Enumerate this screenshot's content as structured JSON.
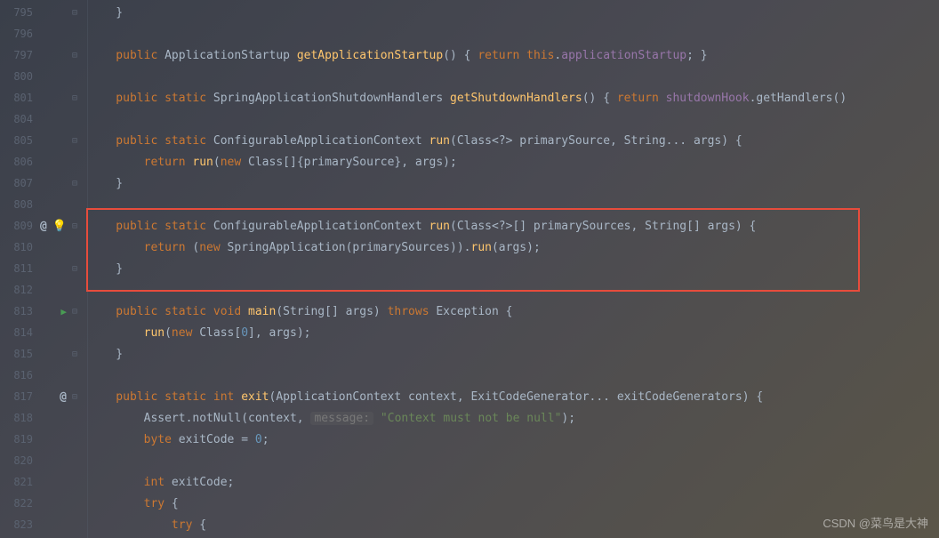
{
  "lines": [
    {
      "num": "795",
      "marks": [
        "fold"
      ],
      "code": [
        {
          "c": "punct",
          "t": "    }"
        }
      ]
    },
    {
      "num": "796",
      "marks": [],
      "code": []
    },
    {
      "num": "797",
      "marks": [
        "fold"
      ],
      "code": [
        {
          "c": "kw",
          "t": "    public "
        },
        {
          "c": "type",
          "t": "ApplicationStartup "
        },
        {
          "c": "method",
          "t": "getApplicationStartup"
        },
        {
          "c": "punct",
          "t": "() { "
        },
        {
          "c": "kw",
          "t": "return this"
        },
        {
          "c": "punct",
          "t": "."
        },
        {
          "c": "field",
          "t": "applicationStartup"
        },
        {
          "c": "punct",
          "t": "; }"
        }
      ]
    },
    {
      "num": "800",
      "marks": [],
      "code": []
    },
    {
      "num": "801",
      "marks": [
        "fold"
      ],
      "code": [
        {
          "c": "kw",
          "t": "    public static "
        },
        {
          "c": "type",
          "t": "SpringApplicationShutdownHandlers "
        },
        {
          "c": "method",
          "t": "getShutdownHandlers"
        },
        {
          "c": "punct",
          "t": "() { "
        },
        {
          "c": "kw",
          "t": "return "
        },
        {
          "c": "field",
          "t": "shutdownHook"
        },
        {
          "c": "punct",
          "t": ".getHandlers()"
        }
      ]
    },
    {
      "num": "804",
      "marks": [],
      "code": []
    },
    {
      "num": "805",
      "marks": [
        "fold"
      ],
      "code": [
        {
          "c": "kw",
          "t": "    public static "
        },
        {
          "c": "type",
          "t": "ConfigurableApplicationContext "
        },
        {
          "c": "method",
          "t": "run"
        },
        {
          "c": "punct",
          "t": "(Class<?> primarySource, String... args) {"
        }
      ]
    },
    {
      "num": "806",
      "marks": [],
      "code": [
        {
          "c": "kw",
          "t": "        return "
        },
        {
          "c": "method",
          "t": "run"
        },
        {
          "c": "punct",
          "t": "("
        },
        {
          "c": "kw",
          "t": "new "
        },
        {
          "c": "punct",
          "t": "Class[]{primarySource}, args);"
        }
      ]
    },
    {
      "num": "807",
      "marks": [
        "fold"
      ],
      "code": [
        {
          "c": "punct",
          "t": "    }"
        }
      ]
    },
    {
      "num": "808",
      "marks": [],
      "code": []
    },
    {
      "num": "809",
      "marks": [
        "at",
        "bulb",
        "fold"
      ],
      "code": [
        {
          "c": "kw",
          "t": "    public static "
        },
        {
          "c": "type",
          "t": "ConfigurableApplicationContext "
        },
        {
          "c": "method",
          "t": "run"
        },
        {
          "c": "punct",
          "t": "(Class<?>[] primarySources, String[] args) {"
        }
      ]
    },
    {
      "num": "810",
      "marks": [],
      "code": [
        {
          "c": "kw",
          "t": "        return "
        },
        {
          "c": "punct",
          "t": "("
        },
        {
          "c": "kw",
          "t": "new "
        },
        {
          "c": "type",
          "t": "SpringApplication"
        },
        {
          "c": "punct",
          "t": "(primarySources))."
        },
        {
          "c": "method",
          "t": "run"
        },
        {
          "c": "punct",
          "t": "(args);"
        }
      ]
    },
    {
      "num": "811",
      "marks": [
        "fold"
      ],
      "code": [
        {
          "c": "punct",
          "t": "    }"
        }
      ]
    },
    {
      "num": "812",
      "marks": [],
      "code": []
    },
    {
      "num": "813",
      "marks": [
        "play",
        "fold"
      ],
      "code": [
        {
          "c": "kw",
          "t": "    public static void "
        },
        {
          "c": "method",
          "t": "main"
        },
        {
          "c": "punct",
          "t": "(String[] args) "
        },
        {
          "c": "kw",
          "t": "throws "
        },
        {
          "c": "type",
          "t": "Exception {"
        }
      ]
    },
    {
      "num": "814",
      "marks": [],
      "code": [
        {
          "c": "method",
          "t": "        run"
        },
        {
          "c": "punct",
          "t": "("
        },
        {
          "c": "kw",
          "t": "new "
        },
        {
          "c": "punct",
          "t": "Class["
        },
        {
          "c": "num",
          "t": "0"
        },
        {
          "c": "punct",
          "t": "], args);"
        }
      ]
    },
    {
      "num": "815",
      "marks": [
        "fold"
      ],
      "code": [
        {
          "c": "punct",
          "t": "    }"
        }
      ]
    },
    {
      "num": "816",
      "marks": [],
      "code": []
    },
    {
      "num": "817",
      "marks": [
        "at",
        "fold"
      ],
      "code": [
        {
          "c": "kw",
          "t": "    public static int "
        },
        {
          "c": "method",
          "t": "exit"
        },
        {
          "c": "punct",
          "t": "(ApplicationContext context, ExitCodeGenerator... exitCodeGenerators) {"
        }
      ]
    },
    {
      "num": "818",
      "marks": [],
      "code": [
        {
          "c": "type",
          "t": "        Assert"
        },
        {
          "c": "punct",
          "t": ".notNull(context, "
        },
        {
          "c": "hint",
          "t": "message:"
        },
        {
          "c": "punct",
          "t": " "
        },
        {
          "c": "str",
          "t": "\"Context must not be null\""
        },
        {
          "c": "punct",
          "t": ");"
        }
      ]
    },
    {
      "num": "819",
      "marks": [],
      "code": [
        {
          "c": "kw",
          "t": "        byte "
        },
        {
          "c": "param",
          "t": "exitCode"
        },
        {
          "c": "punct",
          "t": " = "
        },
        {
          "c": "num",
          "t": "0"
        },
        {
          "c": "punct",
          "t": ";"
        }
      ]
    },
    {
      "num": "820",
      "marks": [],
      "code": []
    },
    {
      "num": "821",
      "marks": [],
      "code": [
        {
          "c": "kw",
          "t": "        int "
        },
        {
          "c": "param",
          "t": "exitCode;"
        }
      ]
    },
    {
      "num": "822",
      "marks": [],
      "code": [
        {
          "c": "kw",
          "t": "        try "
        },
        {
          "c": "punct",
          "t": "{"
        }
      ]
    },
    {
      "num": "823",
      "marks": [],
      "code": [
        {
          "c": "kw",
          "t": "            try "
        },
        {
          "c": "punct",
          "t": "{"
        }
      ]
    }
  ],
  "watermark": "CSDN @菜鸟是大神"
}
